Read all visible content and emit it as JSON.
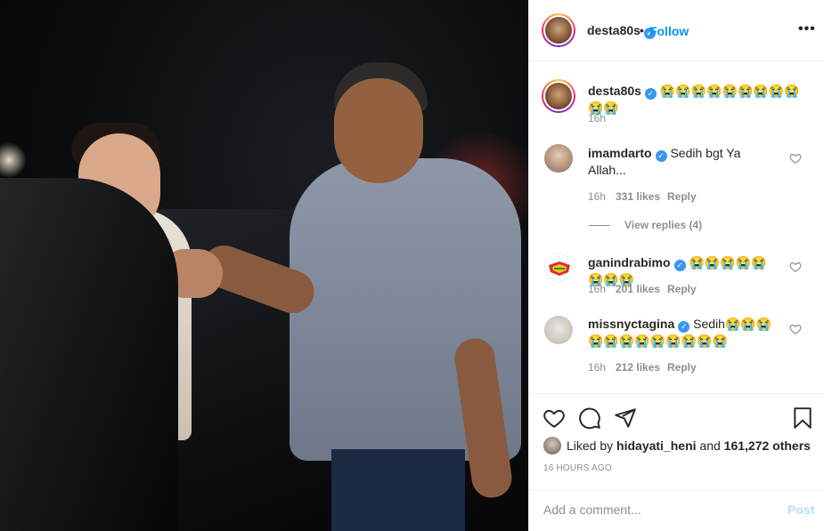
{
  "post": {
    "author": "desta80s",
    "follow_label": "Follow",
    "dot": "•",
    "more_label": "•••",
    "verified_mark": "✓"
  },
  "caption": {
    "username": "desta80s",
    "text": "😭😭😭😭😭😭😭😭😭😭😭",
    "time": "16h"
  },
  "comments": [
    {
      "username": "imamdarto",
      "text": "Sedih bgt Ya Allah...",
      "time": "16h",
      "likes": "331 likes",
      "reply": "Reply",
      "view_replies": "View replies (4)"
    },
    {
      "username": "ganindrabimo",
      "text": "😭😭😭😭😭😭😭😭",
      "time": "16h",
      "likes": "201 likes",
      "reply": "Reply"
    },
    {
      "username": "missnyctagina",
      "text": "Sedih😭😭😭😭😭😭😭😭😭😭😭😭",
      "time": "16h",
      "likes": "212 likes",
      "reply": "Reply"
    }
  ],
  "likes": {
    "prefix": "Liked by",
    "user": "hidayati_heni",
    "middle": "and",
    "count": "161,272 others"
  },
  "timestamp": "16 HOURS AGO",
  "comment_box": {
    "placeholder": "Add a comment...",
    "post_label": "Post"
  },
  "colors": {
    "accent": "#0095f6",
    "verified": "#3897f0",
    "muted": "#8e8e8e"
  },
  "icons": [
    "heart-icon",
    "comment-icon",
    "share-icon",
    "bookmark-icon",
    "more-options-icon",
    "verified-badge-icon"
  ]
}
